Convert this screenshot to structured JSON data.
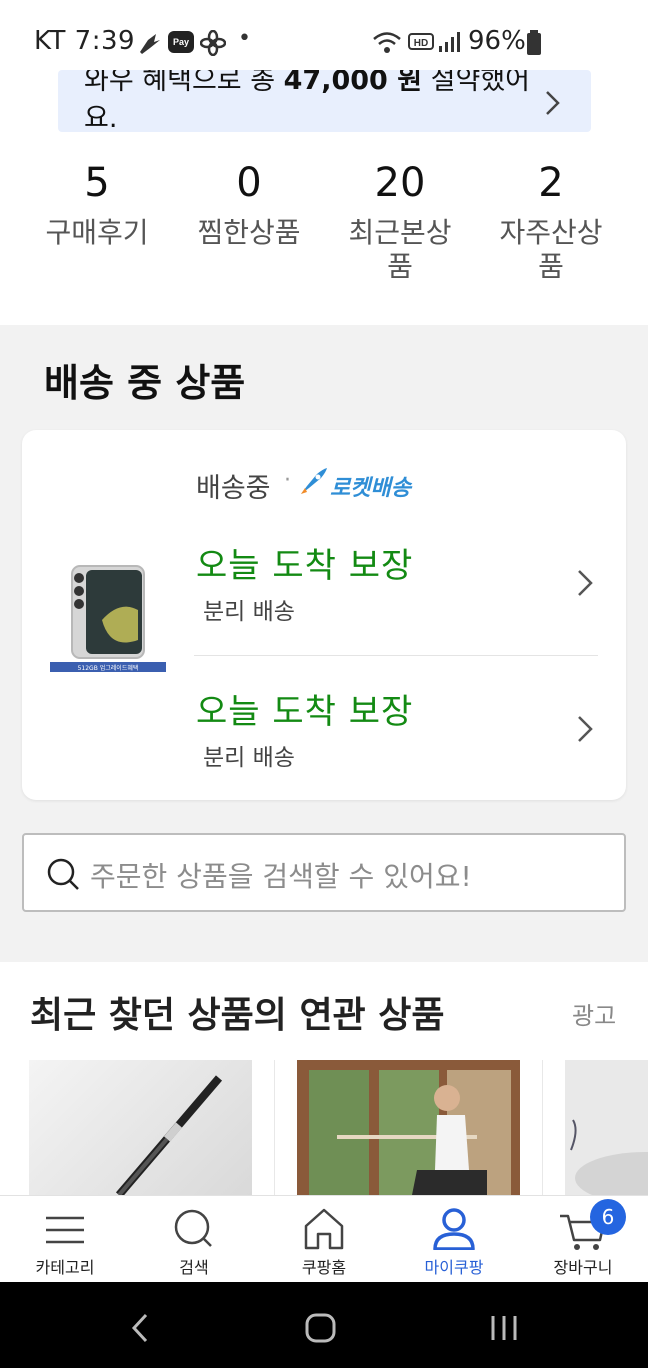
{
  "status_bar": {
    "carrier_time": "KT 7:39",
    "pay_badge": "Pay",
    "dot": "•",
    "battery": "96%"
  },
  "savings_banner": {
    "prefix": "와우 혜택으로 총 ",
    "amount": "47,000 원",
    "suffix": " 절약했어요."
  },
  "stats": [
    {
      "count": "5",
      "label": "구매후기"
    },
    {
      "count": "0",
      "label": "찜한상품"
    },
    {
      "count": "20",
      "label": "최근본상품"
    },
    {
      "count": "2",
      "label": "자주산상품"
    }
  ],
  "shipping": {
    "title": "배송 중 상품",
    "status": "배송중",
    "dot": "·",
    "delivery_type": "로켓배송",
    "product_tag": "512GB 업그레이드혜택",
    "items": [
      {
        "title": "오늘 도착 보장",
        "subtitle": "분리 배송"
      },
      {
        "title": "오늘 도착 보장",
        "subtitle": "분리 배송"
      }
    ]
  },
  "order_search": {
    "placeholder": "주문한 상품을 검색할 수 있어요!"
  },
  "recommended": {
    "title": "최근 찾던 상품의 연관 상품",
    "ad_label": "광고"
  },
  "bottom_nav": {
    "items": [
      {
        "label": "카테고리",
        "icon": "menu-icon"
      },
      {
        "label": "검색",
        "icon": "search-icon"
      },
      {
        "label": "쿠팡홈",
        "icon": "home-icon"
      },
      {
        "label": "마이쿠팡",
        "icon": "person-icon"
      },
      {
        "label": "장바구니",
        "icon": "cart-icon"
      }
    ],
    "active_index": 3,
    "cart_count": "6"
  },
  "colors": {
    "accent_blue": "#2860d6",
    "green": "#138a13",
    "banner_bg": "#e8effd",
    "rocket_blue": "#2f8ed6"
  }
}
